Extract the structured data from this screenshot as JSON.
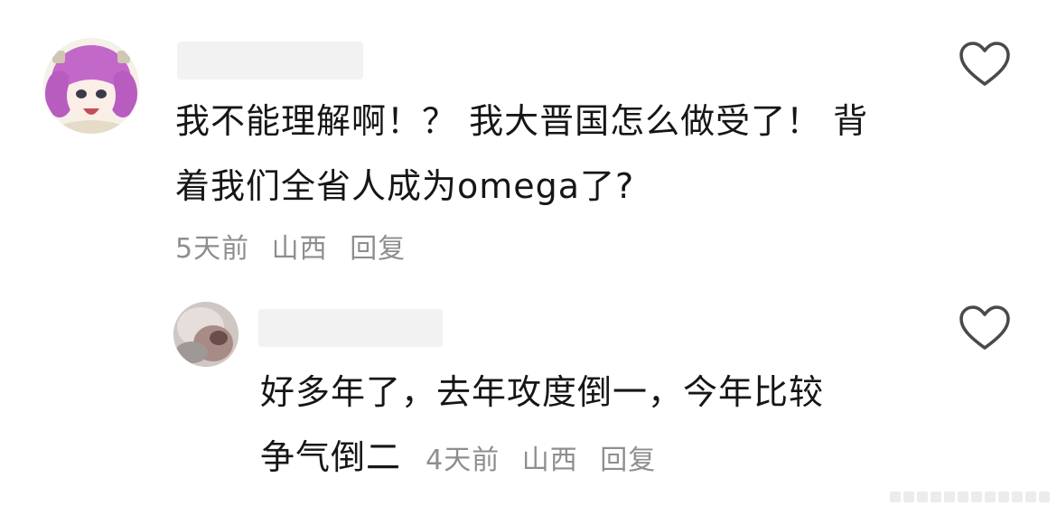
{
  "comments": [
    {
      "text_line1": "我不能理解啊！？ 我大晋国怎么做受了！ 背",
      "text_line2": "着我们全省人成为omega了?",
      "time": "5天前",
      "location": "山西",
      "reply_label": "回复"
    },
    {
      "text_line1": "好多年了，去年攻度倒一，今年比较",
      "text_line2": "争气倒二",
      "time": "4天前",
      "location": "山西",
      "reply_label": "回复"
    }
  ],
  "icons": {
    "like": "heart-outline-icon"
  },
  "colors": {
    "text": "#161616",
    "meta": "#8e8e8e",
    "background": "#ffffff"
  }
}
